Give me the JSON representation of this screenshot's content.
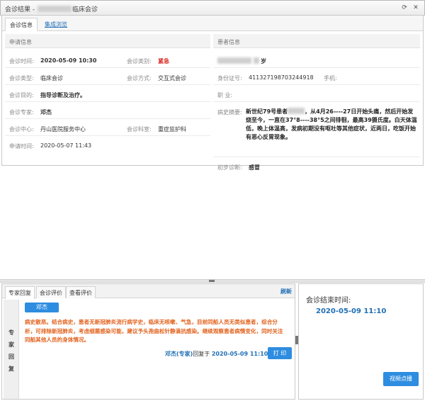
{
  "window": {
    "title_prefix": "会诊结果 - ",
    "title_suffix": "临床会诊"
  },
  "tabs_top": [
    {
      "label": "会诊信息"
    },
    {
      "label": "集成浏览"
    }
  ],
  "request": {
    "section": "申请信息",
    "time_label": "会诊时间:",
    "time_value": "2020-05-09 10:30",
    "category_label": "会诊类别:",
    "category_value": "紧急",
    "type_label": "会诊类型:",
    "type_value": "临床会诊",
    "method_label": "会诊方式:",
    "method_value": "交互式会诊",
    "purpose_label": "会诊目的:",
    "purpose_value": "指导诊断及治疗。",
    "expert_label": "会诊专家:",
    "expert_value": "邓杰",
    "center_label": "会诊中心:",
    "center_value": "丹山医院服务中心",
    "dept_label": "会诊科室:",
    "dept_value": "重症监护科",
    "apply_time_label": "申请时间:",
    "apply_time_value": "2020-05-07 11:43"
  },
  "patient": {
    "section": "患者信息",
    "age_suffix": "岁",
    "id_label": "身份证号:",
    "id_value": "411327198703244918",
    "phone_label": "手机:",
    "job_label": "职  业:",
    "history_label": "病史摘要:",
    "history_value_1": "新世纪79号患者",
    "history_value_2": "，从4月26----27日开始头痛，然后开始发烧至今，一直在37°8----38°5之间徘徊，最高39摄氏度。白天体温低，晚上体温高，发病初期没有呕吐等其他症状，近两日，吃饭开始有恶心反胃现象。",
    "diagnosis_label": "初步诊断:",
    "diagnosis_value": "感冒"
  },
  "tabs_bottom": [
    {
      "label": "专家回复"
    },
    {
      "label": "会诊评价"
    },
    {
      "label": "查看评价"
    }
  ],
  "refresh_label": "刷新",
  "reply": {
    "side_label": [
      "专",
      "家",
      "回",
      "复"
    ],
    "expert_button": "邓杰",
    "text": "病史散恶。结合病史，患者无新冠肺炎流行病学史，临床无咳嗽、气急，目前同船人员无类似患者，综合分析，可排除新冠肺炎，考虑细菌感染可能，建议予头孢曲松针静滴抗感染。继续观察患者病情变化，同时关注同船其他人员的身体情况。",
    "meta_name": "邓杰(专家)",
    "meta_mid": "回复于",
    "meta_time": "2020-05-09 11:10",
    "print_label": "打 印"
  },
  "end": {
    "label": "会诊结束时间:",
    "value": "2020-05-09 11:10",
    "video_button": "视频点播"
  },
  "colors": {
    "accent": "#2e8de0",
    "link": "#1f6fb5",
    "urgent": "#d9231d",
    "reply_text": "#e2631f"
  }
}
